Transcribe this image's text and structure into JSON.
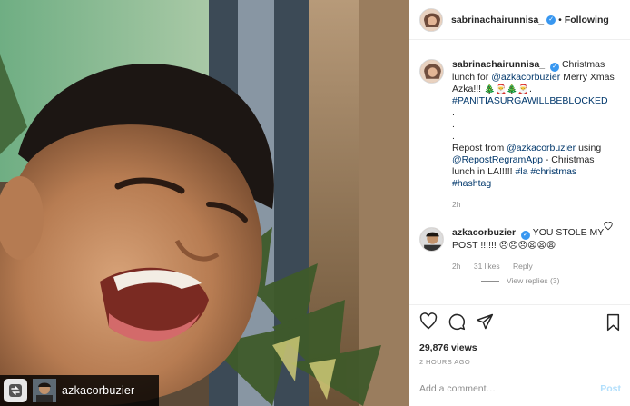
{
  "media": {
    "repost_username": "azkacorbuzier"
  },
  "header": {
    "username": "sabrinachairunnisa_",
    "separator": "•",
    "follow_status": "Following"
  },
  "caption": {
    "username": "sabrinachairunnisa_",
    "text_1": "Christmas lunch for",
    "mention_1": "@azkacorbuzier",
    "text_2": "Merry Xmas Azka!!!",
    "emojis_1": "🎄🎅🎄🎅.",
    "hashtag_1": "#PANITIASURGAWILLBEBLOCKED",
    "dot_a": ".",
    "dot_b": ".",
    "dot_c": ".",
    "text_3": "Repost from",
    "mention_2": "@azkacorbuzier",
    "text_4": "using",
    "mention_3": "@RepostRegramApp",
    "text_5": "- Christmas lunch in LA!!!!!",
    "hashtag_2": "#la",
    "hashtag_3": "#christmas",
    "hashtag_4": "#hashtag",
    "time": "2h"
  },
  "reply": {
    "username": "azkacorbuzier",
    "text": "YOU STOLE MY POST !!!!!!",
    "emojis": "😠😠😠😫😫😩",
    "time": "2h",
    "likes": "31 likes",
    "reply_label": "Reply",
    "view_replies": "View replies (3)"
  },
  "actions": {
    "likes": "29,876 views",
    "age": "2 HOURS AGO"
  },
  "comment_box": {
    "placeholder": "Add a comment…",
    "post_label": "Post"
  },
  "colors": {
    "link": "#00376b",
    "verified": "#3897f0",
    "muted": "#8e8e8e",
    "post_disabled": "#b2dffc"
  },
  "icons": [
    "heart-icon",
    "comment-icon",
    "share-icon",
    "bookmark-icon",
    "verified-icon",
    "repost-icon"
  ]
}
